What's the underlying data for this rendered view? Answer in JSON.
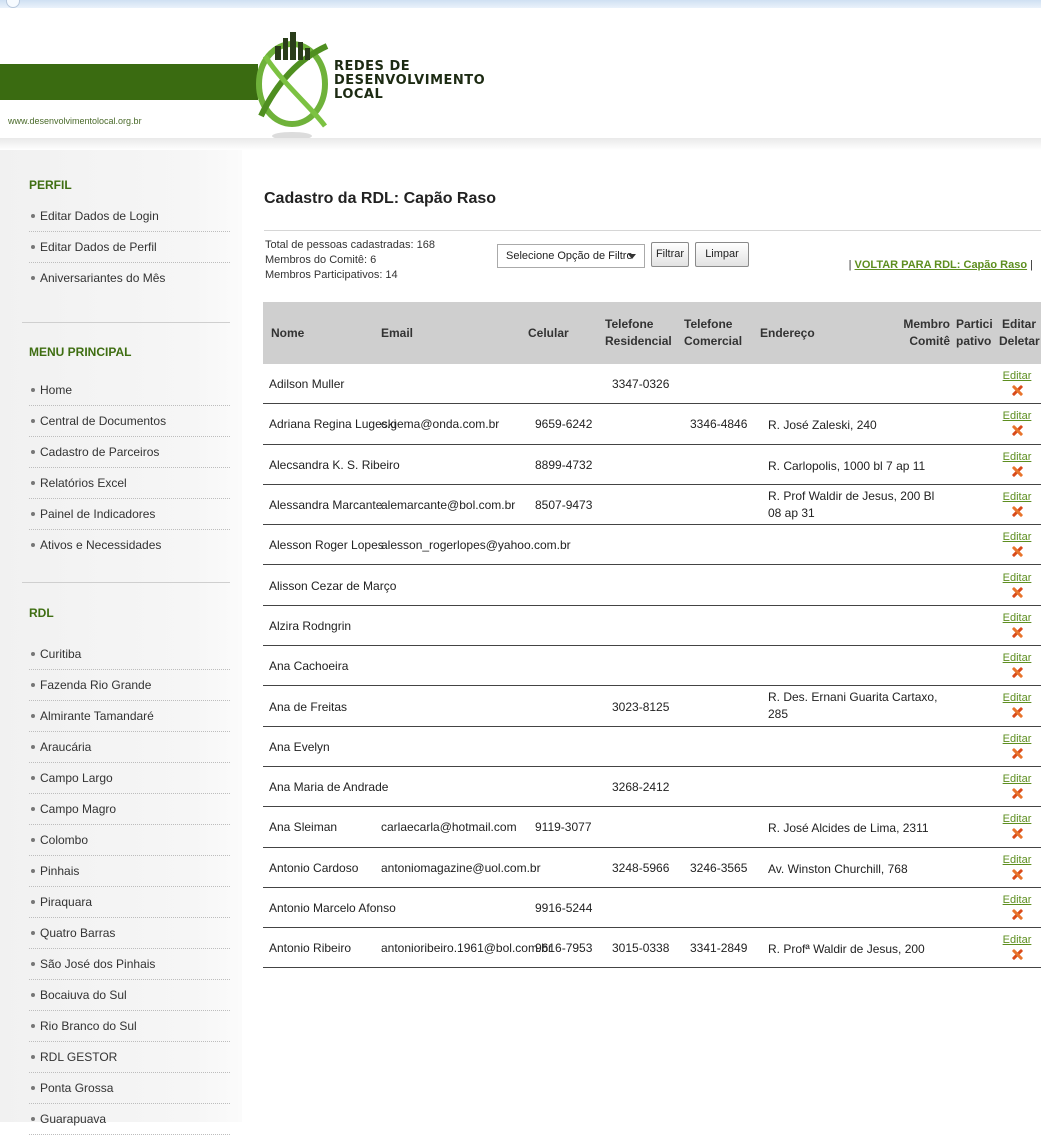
{
  "header": {
    "site_url": "www.desenvolvimentolocal.org.br",
    "logo_lines": [
      "REDES DE",
      "DESENVOLVIMENTO",
      "LOCAL"
    ]
  },
  "sidebar": {
    "perfil_title": "PERFIL",
    "perfil_items": [
      "Editar Dados de Login",
      "Editar Dados de Perfil",
      "Aniversariantes do Mês"
    ],
    "menu_title": "MENU PRINCIPAL",
    "menu_items": [
      "Home",
      "Central de Documentos",
      "Cadastro de Parceiros",
      "Relatórios Excel",
      "Painel de Indicadores",
      "Ativos e Necessidades"
    ],
    "rdl_title": "RDL",
    "rdl_items": [
      "Curitiba",
      "Fazenda Rio Grande",
      "Almirante Tamandaré",
      "Araucária",
      "Campo Largo",
      "Campo Magro",
      "Colombo",
      "Pinhais",
      "Piraquara",
      "Quatro Barras",
      "São José dos Pinhais",
      "Bocaiuva do Sul",
      "Rio Branco do Sul",
      "RDL GESTOR",
      "Ponta Grossa",
      "Guarapuava"
    ]
  },
  "main": {
    "title": "Cadastro da RDL: Capão Raso",
    "stats": [
      "Total de pessoas cadastradas: 168",
      "Membros do Comitê: 6",
      "Membros Participativos: 14"
    ],
    "filter_selected": "Selecione Opção de Filtro",
    "filter_button": "Filtrar",
    "clear_button": "Limpar",
    "voltar_sep": "|",
    "voltar_link": "VOLTAR PARA RDL: Capão Raso"
  },
  "table": {
    "headers": {
      "nome": "Nome",
      "email": "Email",
      "celular": "Celular",
      "tel_res": [
        "Telefone",
        "Residencial"
      ],
      "tel_com": [
        "Telefone",
        "Comercial"
      ],
      "endereco": "Endereço",
      "membro": [
        "Membro",
        "Comitê"
      ],
      "partici": [
        "Partici",
        "pativo"
      ],
      "editar": [
        "Editar",
        "Deletar"
      ]
    },
    "edit_label": "Editar",
    "rows": [
      {
        "nome": "Adilson Muller",
        "email": "",
        "celular": "",
        "res": "3347-0326",
        "com": "",
        "end": [
          "",
          ""
        ]
      },
      {
        "nome": "Adriana Regina Lugeski",
        "email": "c.gema@onda.com.br",
        "celular": "9659-6242",
        "res": "",
        "com": "3346-4846",
        "end": [
          "R. José Zaleski, 240",
          ""
        ]
      },
      {
        "nome": "Alecsandra K. S. Ribeiro",
        "email": "",
        "celular": "8899-4732",
        "res": "",
        "com": "",
        "end": [
          "R. Carlopolis, 1000 bl 7 ap 11",
          ""
        ]
      },
      {
        "nome": "Alessandra Marcante",
        "email": "alemarcante@bol.com.br",
        "celular": "8507-9473",
        "res": "",
        "com": "",
        "end": [
          "R. Prof Waldir de Jesus, 200 Bl",
          "08 ap 31"
        ]
      },
      {
        "nome": "Alesson Roger Lopes",
        "email": "alesson_rogerlopes@yahoo.com.br",
        "celular": "",
        "res": "",
        "com": "",
        "end": [
          "",
          ""
        ]
      },
      {
        "nome": "Alisson Cezar de Março",
        "email": "",
        "celular": "",
        "res": "",
        "com": "",
        "end": [
          "",
          ""
        ]
      },
      {
        "nome": "Alzira Rodngrin",
        "email": "",
        "celular": "",
        "res": "",
        "com": "",
        "end": [
          "",
          ""
        ]
      },
      {
        "nome": "Ana Cachoeira",
        "email": "",
        "celular": "",
        "res": "",
        "com": "",
        "end": [
          "",
          ""
        ]
      },
      {
        "nome": "Ana de Freitas",
        "email": "",
        "celular": "",
        "res": "3023-8125",
        "com": "",
        "end": [
          "R. Des. Ernani Guarita Cartaxo,",
          "285"
        ]
      },
      {
        "nome": "Ana Evelyn",
        "email": "",
        "celular": "",
        "res": "",
        "com": "",
        "end": [
          "",
          ""
        ]
      },
      {
        "nome": "Ana Maria de Andrade",
        "email": "",
        "celular": "",
        "res": "3268-2412",
        "com": "",
        "end": [
          "",
          ""
        ]
      },
      {
        "nome": "Ana Sleiman",
        "email": "carlaecarla@hotmail.com",
        "celular": "9119-3077",
        "res": "",
        "com": "",
        "end": [
          "R. José Alcides de Lima, 2311",
          ""
        ]
      },
      {
        "nome": "Antonio Cardoso",
        "email": "antoniomagazine@uol.com.br",
        "celular": "",
        "res": "3248-5966",
        "com": "3246-3565",
        "end": [
          "Av. Winston Churchill, 768",
          ""
        ]
      },
      {
        "nome": "Antonio Marcelo Afonso",
        "email": "",
        "celular": "9916-5244",
        "res": "",
        "com": "",
        "end": [
          "",
          ""
        ]
      },
      {
        "nome": "Antonio Ribeiro",
        "email": "antonioribeiro.1961@bol.com.br",
        "celular": "9616-7953",
        "res": "3015-0338",
        "com": "3341-2849",
        "end": [
          "R. Profª Waldir de Jesus, 200",
          ""
        ]
      }
    ]
  }
}
